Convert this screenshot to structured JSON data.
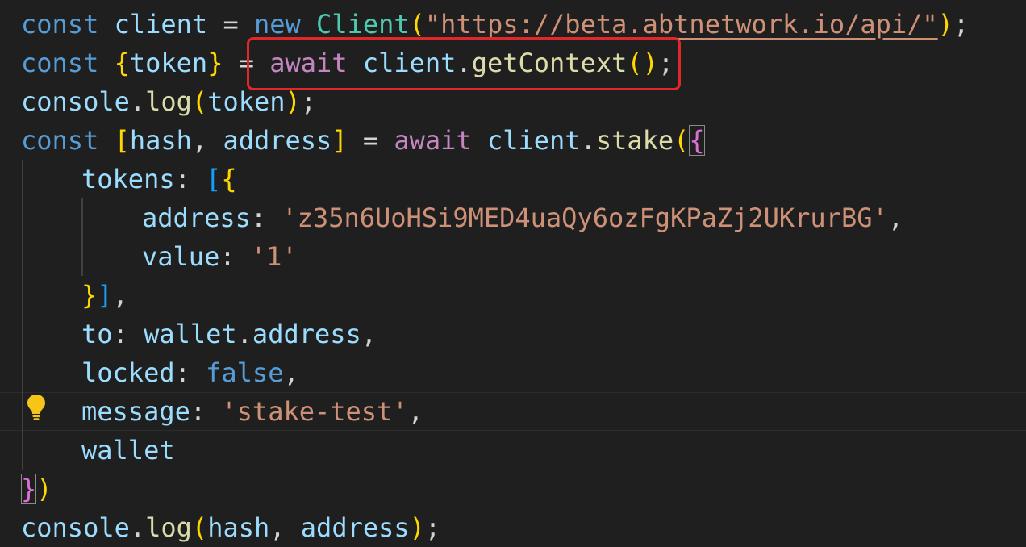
{
  "colors": {
    "background": "#1f1f1f",
    "highlight_box": "#e0282b",
    "lightbulb": "#f5c518"
  },
  "icons": {
    "lightbulb": "lightbulb-icon"
  },
  "code": {
    "l1": {
      "a": "const",
      "b": " client ",
      "c": "=",
      "d": " new ",
      "e": "Client",
      "f": "(",
      "g": "\"https://beta.abtnetwork.io/api/\"",
      "h": ")",
      "i": ";"
    },
    "l2": {
      "a": "const",
      "b": " ",
      "c": "{",
      "d": "token",
      "e": "}",
      "f": " = ",
      "g": "await",
      "h": " client",
      "i": ".",
      "j": "getContext",
      "k": "()",
      "l": ";"
    },
    "l3": {
      "a": "console",
      "b": ".",
      "c": "log",
      "d": "(",
      "e": "token",
      "f": ")",
      "g": ";"
    },
    "l4": {
      "a": "const",
      "b": " ",
      "c": "[",
      "d": "hash",
      "e": ", ",
      "f": "address",
      "g": "]",
      "h": " = ",
      "i": "await",
      "j": " client",
      "k": ".",
      "l": "stake",
      "m": "(",
      "n": "{"
    },
    "l5": {
      "a": "tokens",
      "b": ": ",
      "c": "[",
      "d": "{"
    },
    "l6": {
      "a": "address",
      "b": ": ",
      "c": "'z35n6UoHSi9MED4uaQy6ozFgKPaZj2UKrurBG'",
      "d": ","
    },
    "l7": {
      "a": "value",
      "b": ": ",
      "c": "'1'"
    },
    "l8": {
      "a": "}",
      "b": "]",
      "c": ","
    },
    "l9": {
      "a": "to",
      "b": ": ",
      "c": "wallet",
      "d": ".",
      "e": "address",
      "f": ","
    },
    "l10": {
      "a": "locked",
      "b": ": ",
      "c": "false",
      "d": ","
    },
    "l11": {
      "a": "message",
      "b": ": ",
      "c": "'stake-test'",
      "d": ","
    },
    "l12": {
      "a": "wallet"
    },
    "l13": {
      "a": "}",
      "b": ")"
    },
    "l14": {
      "a": "console",
      "b": ".",
      "c": "log",
      "d": "(",
      "e": "hash",
      "f": ", ",
      "g": "address",
      "h": ")",
      "i": ";"
    }
  }
}
